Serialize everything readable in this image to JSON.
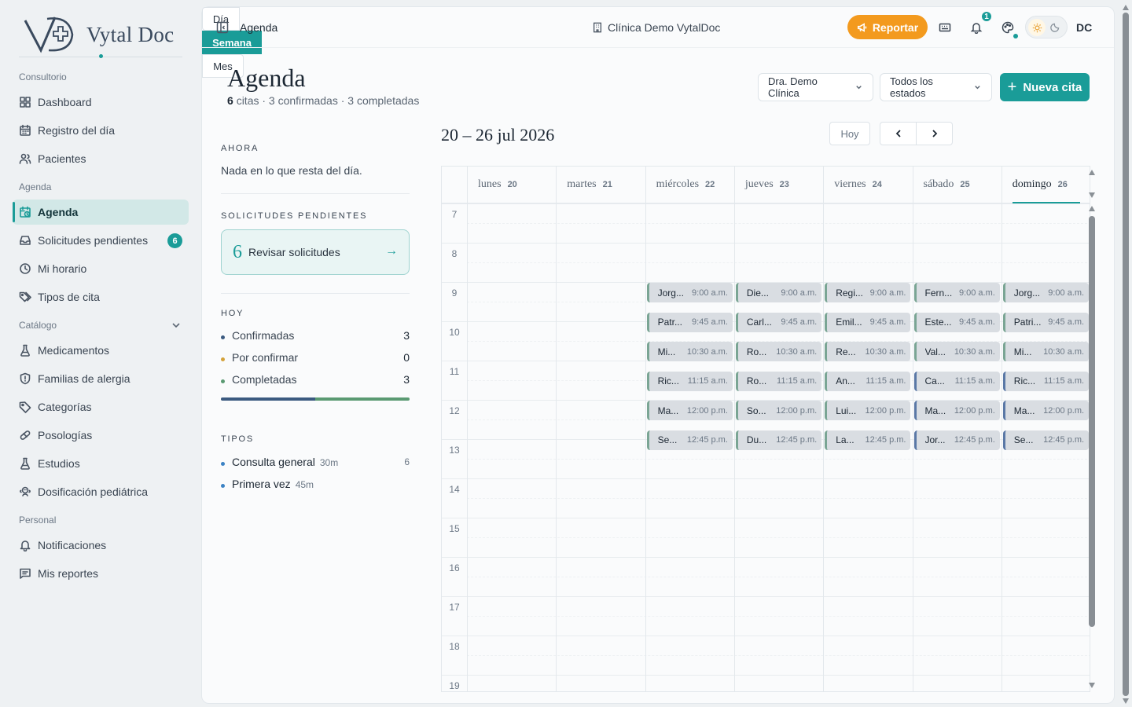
{
  "brand": {
    "name": "Vytal Doc",
    "accent": "#1a9c98"
  },
  "sidebar": {
    "sections": [
      "Consultorio",
      "Agenda",
      "Catálogo",
      "Personal"
    ],
    "items": [
      {
        "label": "Dashboard",
        "icon": "grid-icon"
      },
      {
        "label": "Registro del día",
        "icon": "calendar-icon"
      },
      {
        "label": "Pacientes",
        "icon": "users-icon"
      },
      {
        "label": "Agenda",
        "icon": "calendar-clock-icon",
        "active": true
      },
      {
        "label": "Solicitudes pendientes",
        "icon": "inbox-icon",
        "badge": "6"
      },
      {
        "label": "Mi horario",
        "icon": "clock-icon"
      },
      {
        "label": "Tipos de cita",
        "icon": "tags-icon"
      },
      {
        "label": "Medicamentos",
        "icon": "flask-icon"
      },
      {
        "label": "Familias de alergia",
        "icon": "shield-icon"
      },
      {
        "label": "Categorías",
        "icon": "tag-icon"
      },
      {
        "label": "Posologías",
        "icon": "pill-icon"
      },
      {
        "label": "Estudios",
        "icon": "flask-icon"
      },
      {
        "label": "Dosificación pediátrica",
        "icon": "baby-icon"
      },
      {
        "label": "Notificaciones",
        "icon": "bell-icon"
      },
      {
        "label": "Mis reportes",
        "icon": "message-icon"
      }
    ]
  },
  "topbar": {
    "title": "Agenda",
    "clinic": "Clínica Demo VytalDoc",
    "report": "Reportar",
    "notif_count": "1",
    "avatar": "DC"
  },
  "page": {
    "title": "Agenda",
    "count": "6",
    "sub": "citas · 3 confirmadas · 3 completadas",
    "doctor": "Dra. Demo Clínica",
    "status": "Todos los estados",
    "new": "Nueva cita"
  },
  "panel": {
    "now_label": "AHORA",
    "now_text": "Nada en lo que resta del día.",
    "pending_label": "SOLICITUDES PENDIENTES",
    "pending_count": "6",
    "pending_text": "Revisar solicitudes",
    "today_label": "HOY",
    "stats": [
      {
        "label": "Confirmadas",
        "value": "3",
        "color": "#3b5a80"
      },
      {
        "label": "Por confirmar",
        "value": "0",
        "color": "#d4a23a"
      },
      {
        "label": "Completadas",
        "value": "3",
        "color": "#5a9a72"
      }
    ],
    "types_label": "TIPOS",
    "types": [
      {
        "label": "Consulta general",
        "dur": "30m",
        "count": "6"
      },
      {
        "label": "Primera vez",
        "dur": "45m",
        "count": ""
      }
    ]
  },
  "calendar": {
    "range": "20 – 26 jul 2026",
    "today": "Hoy",
    "views": [
      "Día",
      "Semana",
      "Mes"
    ],
    "days": [
      {
        "name": "lunes",
        "num": "20"
      },
      {
        "name": "martes",
        "num": "21"
      },
      {
        "name": "miércoles",
        "num": "22"
      },
      {
        "name": "jueves",
        "num": "23"
      },
      {
        "name": "viernes",
        "num": "24"
      },
      {
        "name": "sábado",
        "num": "25"
      },
      {
        "name": "domingo",
        "num": "26"
      }
    ],
    "hours": [
      "7",
      "8",
      "9",
      "10",
      "11",
      "12",
      "13",
      "14",
      "15",
      "16",
      "17",
      "18",
      "19"
    ],
    "times": [
      "9:00 a.m.",
      "9:45 a.m.",
      "10:30 a.m.",
      "11:15 a.m.",
      "12:00 p.m.",
      "12:45 p.m."
    ],
    "appointments": [
      [
        "Jorg...",
        "Patr...",
        "Mi...",
        "Ric...",
        "Ma...",
        "Se..."
      ],
      [
        "Die...",
        "Carl...",
        "Ro...",
        "Ro...",
        "So...",
        "Du..."
      ],
      [
        "Regi...",
        "Emil...",
        "Re...",
        "An...",
        "Lui...",
        "La..."
      ],
      [
        "Fern...",
        "Este...",
        "Val...",
        "Ca...",
        "Ma...",
        "Jor..."
      ],
      [
        "Jorg...",
        "Patri...",
        "Mi...",
        "Ric...",
        "Ma...",
        "Se..."
      ]
    ]
  }
}
